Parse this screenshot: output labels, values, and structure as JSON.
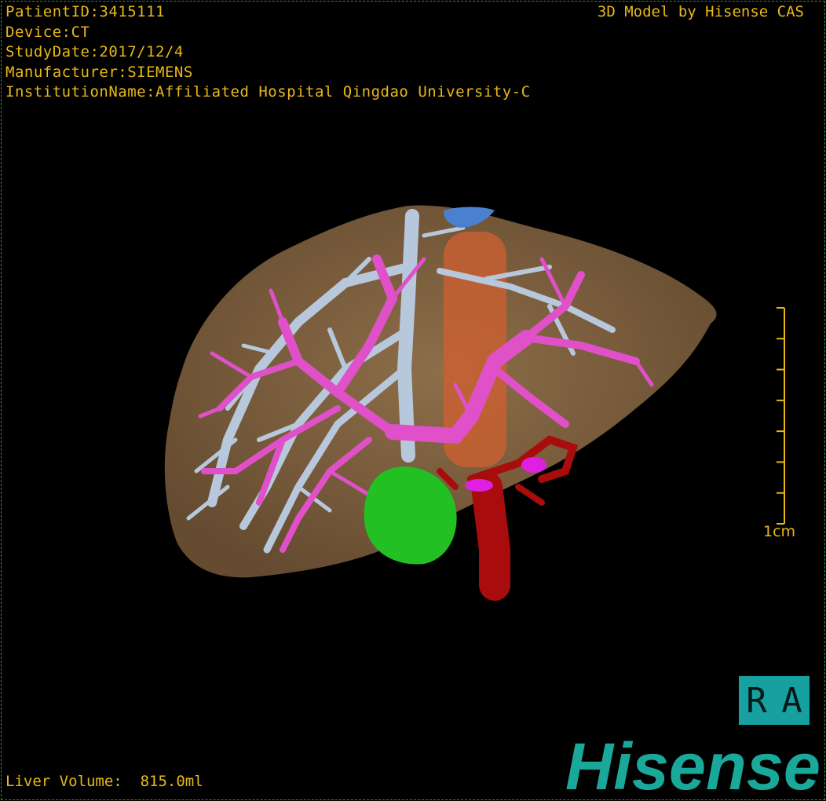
{
  "patient_info": {
    "patient_id": "PatientID:3415111",
    "device": "Device:CT",
    "study_date": "StudyDate:2017/12/4",
    "manufacturer": "Manufacturer:SIEMENS",
    "institution": "InstitutionName:Affiliated Hospital Qingdao University-C"
  },
  "credit": "3D Model by Hisense CAS",
  "liver_volume": "Liver Volume:  815.0ml",
  "scale_bar": {
    "label": "1cm",
    "ticks": 8
  },
  "orientation": {
    "first": "R",
    "second": "A"
  },
  "logo": "Hisense",
  "colors": {
    "text": "#e8b818",
    "liver": "#8a6a45",
    "portal_vein": "#b8c8dc",
    "hepatic_vein": "#e050c8",
    "artery": "#a80c0c",
    "lesion": "#22c022",
    "ivc": "#d06030",
    "brand": "#1aa89a"
  }
}
